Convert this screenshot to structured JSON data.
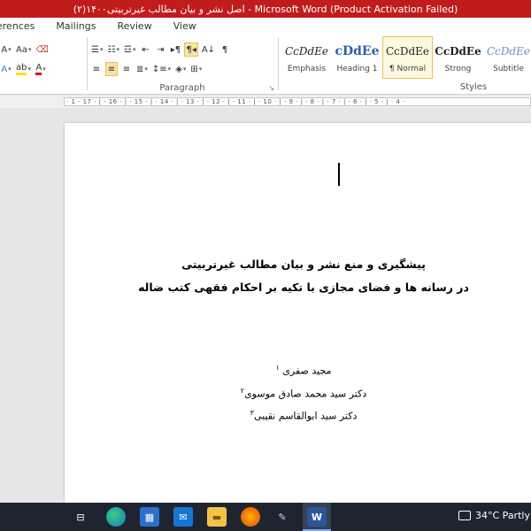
{
  "window": {
    "title": "(۲)اصل نشر و بیان مطالب غیرتربیتی۱۴۰۰ - Microsoft Word (Product Activation Failed)"
  },
  "menu": {
    "tabs": [
      "erences",
      "Mailings",
      "Review",
      "View"
    ]
  },
  "ribbon": {
    "paragraph_label": "Paragraph",
    "styles_label": "Styles",
    "styles": [
      {
        "preview": "CcDdEe",
        "name": "Emphasis"
      },
      {
        "preview": "cDdEe",
        "name": "Heading 1"
      },
      {
        "preview": "CcDdEe",
        "name": "¶ Normal",
        "selected": true
      },
      {
        "preview": "CcDdEe",
        "name": "Strong"
      },
      {
        "preview": "CcDdEe",
        "name": "Subtitle"
      }
    ]
  },
  "ruler": {
    "text": "· 1 · 17 · | · 16 · | · 15 · | · 14 · | · 13 · | · 12 · | · 11 · | · 10 · | · 9 · | · 8 · | · 7 · | · 6 · | · 5 · | · 4 ·"
  },
  "document": {
    "title_line1": "پیشگیری و منع  نشر و بیان مطالب  غیرتربیتی",
    "title_line2": "در رسانه ها  و فضای مجازی با تکیه بر  احکام فقهی کتب ضاله",
    "author1": "مجید صفری",
    "author1_mark": "۱",
    "author2": "دکتر سید محمد صادق موسوی",
    "author2_mark": "۲",
    "author3": "دکتر سید ابوالقاسم نقیبی",
    "author3_mark": "۳"
  },
  "taskbar": {
    "word_label": "W",
    "weather": "34°C  Partly"
  },
  "colors": {
    "titlebar": "#c11c1c",
    "taskbar": "#1f2530",
    "style_selected_border": "#e7c15b"
  }
}
